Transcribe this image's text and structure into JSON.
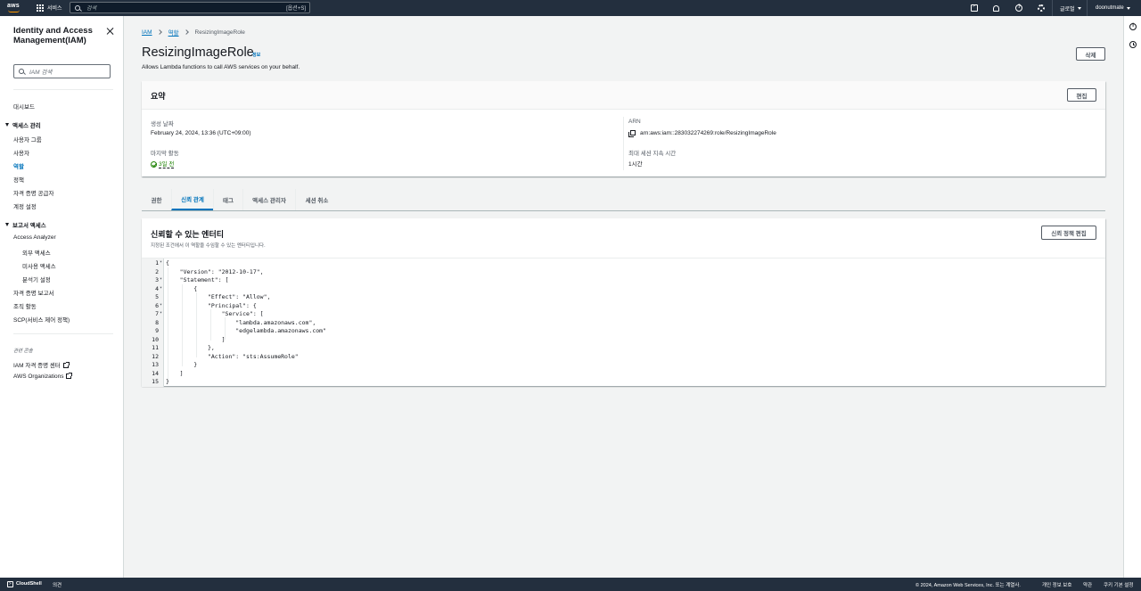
{
  "topnav": {
    "logo": "aws",
    "services": "서비스",
    "search_placeholder": "검색",
    "search_shortcut": "[옵션+S]",
    "region": "글로벌",
    "account": "doonutmate",
    "icons": [
      "cloudshell-icon",
      "bell-icon",
      "help-icon",
      "gear-icon"
    ]
  },
  "sidebar": {
    "title_line1": "Identity and Access",
    "title_line2": "Management(IAM)",
    "search_placeholder": "IAM 검색",
    "dashboard": "대시보드",
    "access_mgmt": {
      "label": "액세스 관리",
      "items": [
        "사용자 그룹",
        "사용자",
        "역할",
        "정책",
        "자격 증명 공급자",
        "계정 설정"
      ]
    },
    "access_reports": {
      "label": "보고서 액세스",
      "analyzer": "Access Analyzer",
      "analyzer_items": [
        "외부 액세스",
        "미사용 액세스",
        "분석기 설정"
      ],
      "items": [
        "자격 증명 보고서",
        "조직 활동",
        "SCP(서비스 제어 정책)"
      ]
    },
    "related": {
      "label": "관련 콘솔",
      "items": [
        "IAM 자격 증명 센터",
        "AWS Organizations"
      ]
    }
  },
  "breadcrumb": {
    "iam": "IAM",
    "roles": "역할",
    "current": "ResizingImageRole"
  },
  "header": {
    "title": "ResizingImageRole",
    "info": "정보",
    "description": "Allows Lambda functions to call AWS services on your behalf.",
    "delete_label": "삭제"
  },
  "summary": {
    "title": "요약",
    "edit_label": "편집",
    "created_label": "생성 날짜",
    "created_value": "February 24, 2024, 13:36 (UTC+09:00)",
    "last_activity_label": "마지막 활동",
    "last_activity_value": "3일 전",
    "arn_label": "ARN",
    "arn_value": "arn:aws:iam::283032274269:role/ResizingImageRole",
    "max_session_label": "최대 세션 지속 시간",
    "max_session_value": "1시간"
  },
  "tabs": [
    {
      "label": "권한",
      "active": false
    },
    {
      "label": "신뢰 관계",
      "active": true
    },
    {
      "label": "태그",
      "active": false
    },
    {
      "label": "액세스 관리자",
      "active": false
    },
    {
      "label": "세션 취소",
      "active": false
    }
  ],
  "trust": {
    "title": "신뢰할 수 있는 엔터티",
    "subtitle": "지정된 조건에서 이 역할을 수임할 수 있는 엔터티입니다.",
    "edit_label": "신뢰 정책 편집",
    "code_lines": [
      {
        "n": "1",
        "fold": true,
        "text": "{"
      },
      {
        "n": "2",
        "fold": false,
        "text": "    \"Version\": \"2012-10-17\","
      },
      {
        "n": "3",
        "fold": true,
        "text": "    \"Statement\": ["
      },
      {
        "n": "4",
        "fold": true,
        "text": "        {"
      },
      {
        "n": "5",
        "fold": false,
        "text": "            \"Effect\": \"Allow\","
      },
      {
        "n": "6",
        "fold": true,
        "text": "            \"Principal\": {"
      },
      {
        "n": "7",
        "fold": true,
        "text": "                \"Service\": ["
      },
      {
        "n": "8",
        "fold": false,
        "text": "                    \"lambda.amazonaws.com\","
      },
      {
        "n": "9",
        "fold": false,
        "text": "                    \"edgelambda.amazonaws.com\""
      },
      {
        "n": "10",
        "fold": false,
        "text": "                ]"
      },
      {
        "n": "11",
        "fold": false,
        "text": "            },"
      },
      {
        "n": "12",
        "fold": false,
        "text": "            \"Action\": \"sts:AssumeRole\""
      },
      {
        "n": "13",
        "fold": false,
        "text": "        }"
      },
      {
        "n": "14",
        "fold": false,
        "text": "    ]"
      },
      {
        "n": "15",
        "fold": false,
        "text": "}"
      }
    ]
  },
  "footer": {
    "cloudshell": "CloudShell",
    "feedback": "의견",
    "copyright": "© 2024, Amazon Web Services, Inc. 또는 계열사.",
    "privacy": "개인 정보 보호",
    "terms": "약관",
    "cookies": "쿠키 기본 설정"
  },
  "colors": {
    "nav": "#232f3e",
    "link": "#0073bb",
    "success": "#1d8102",
    "accent": "#ff9900"
  }
}
